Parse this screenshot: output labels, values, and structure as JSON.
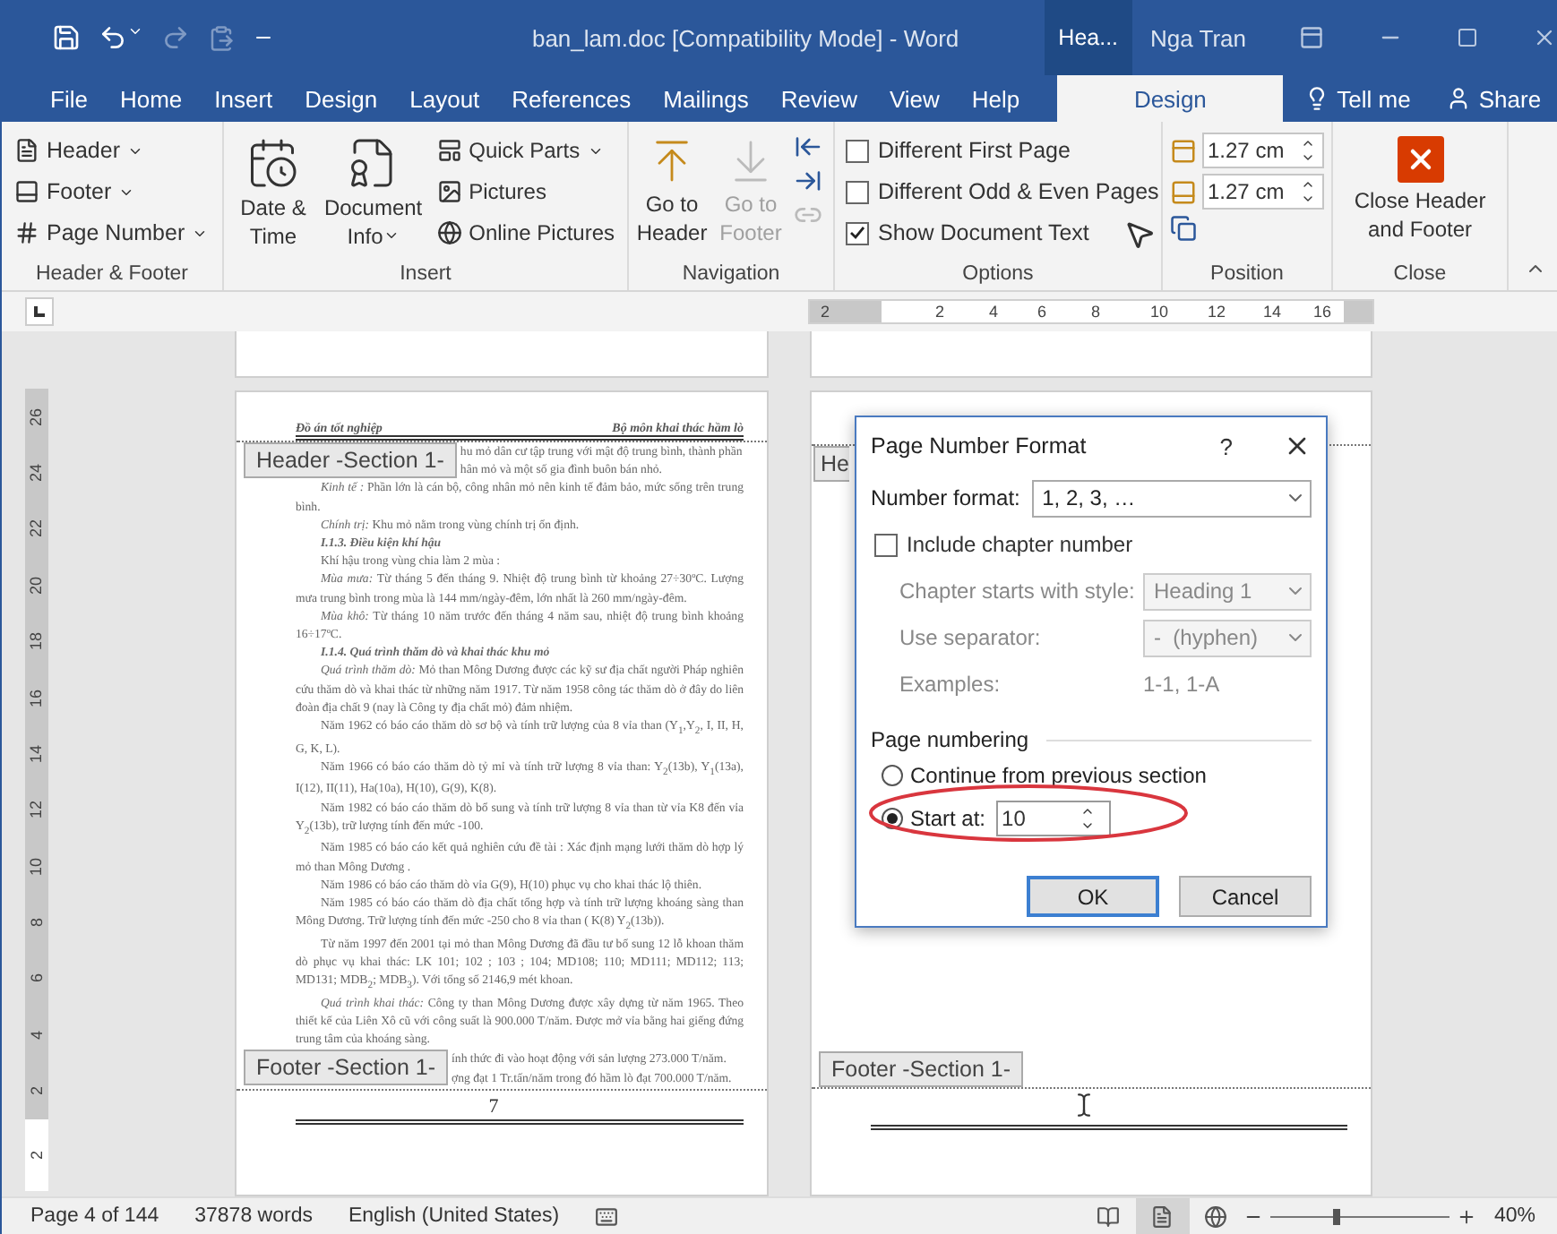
{
  "window": {
    "title": "ban_lam.doc [Compatibility Mode]  -  Word",
    "context_label": "Hea...",
    "user": "Nga Tran"
  },
  "menu_tabs": [
    {
      "label": "File",
      "selected": false
    },
    {
      "label": "Home",
      "selected": false
    },
    {
      "label": "Insert",
      "selected": false
    },
    {
      "label": "Design",
      "selected": false
    },
    {
      "label": "Layout",
      "selected": false
    },
    {
      "label": "References",
      "selected": false
    },
    {
      "label": "Mailings",
      "selected": false
    },
    {
      "label": "Review",
      "selected": false
    },
    {
      "label": "View",
      "selected": false
    },
    {
      "label": "Help",
      "selected": false
    },
    {
      "label": "Design",
      "selected": true
    }
  ],
  "tell_me": "Tell me",
  "share": "Share",
  "ribbon": {
    "header_footer": {
      "label": "Header & Footer",
      "buttons": [
        {
          "label": "Header",
          "dropdown": true
        },
        {
          "label": "Footer",
          "dropdown": true
        },
        {
          "label": "Page Number",
          "dropdown": true
        }
      ]
    },
    "insert": {
      "label": "Insert",
      "large": [
        {
          "label": "Date & Time",
          "dropdown": false
        },
        {
          "label": "Document Info",
          "dropdown": true
        }
      ],
      "small": [
        {
          "label": "Quick Parts",
          "dropdown": true
        },
        {
          "label": "Pictures",
          "dropdown": false
        },
        {
          "label": "Online Pictures",
          "dropdown": false
        }
      ]
    },
    "navigation": {
      "label": "Navigation",
      "buttons": [
        {
          "label": "Go to Header",
          "disabled": false
        },
        {
          "label": "Go to Footer",
          "disabled": true
        }
      ]
    },
    "options": {
      "label": "Options",
      "checks": [
        {
          "label": "Different First Page",
          "checked": false
        },
        {
          "label": "Different Odd & Even Pages",
          "checked": false
        },
        {
          "label": "Show Document Text",
          "checked": true
        }
      ]
    },
    "position": {
      "label": "Position",
      "fields": [
        "1.27 cm",
        "1.27 cm"
      ]
    },
    "close": {
      "label": "Close",
      "button": "Close Header and Footer"
    }
  },
  "ruler": {
    "horizontal": [
      "2",
      "2",
      "4",
      "6",
      "8",
      "10",
      "12",
      "14",
      "16"
    ],
    "vertical": [
      "26",
      "24",
      "22",
      "20",
      "18",
      "16",
      "14",
      "12",
      "10",
      "8",
      "6",
      "4",
      "2"
    ],
    "vertical_below": "2"
  },
  "document": {
    "left_page": {
      "header_left": "Đồ án tốt nghiệp",
      "header_right": "Bộ môn khai thác hầm lò",
      "header_tag": "Header -Section 1-",
      "header_aside": [
        "hu mỏ dân cư tập trung với mật độ trung bình, thành phần",
        "hân mỏ và một số gia đình buôn bán nhỏ."
      ],
      "paragraphs": [
        {
          "kind": "body",
          "text": "*Kinh tế :* Phần lớn là cán bộ, công nhân mỏ nên kinh tế đảm bảo, mức sống trên trung bình."
        },
        {
          "kind": "body",
          "text": "*Chính trị:* Khu mỏ nằm trong vùng chính trị ổn định."
        },
        {
          "kind": "heading",
          "text": "I.1.3. Điều kiện khí hậu"
        },
        {
          "kind": "body",
          "text": "Khí hậu trong vùng chia làm 2 mùa :"
        },
        {
          "kind": "body",
          "text": "*Mùa mưa:* Từ tháng 5 đến tháng 9. Nhiệt độ trung bình từ khoảng 27÷30ºC. Lượng mưa trung bình trong mùa là 144 mm/ngày-đêm, lớn nhất là 260 mm/ngày-đêm."
        },
        {
          "kind": "body",
          "text": "*Mùa khô:* Từ tháng 10 năm trước đến tháng 4 năm sau, nhiệt độ trung bình khoảng 16÷17ºC."
        },
        {
          "kind": "heading",
          "text": "I.1.4. Quá trình thăm dò và khai thác khu mỏ"
        },
        {
          "kind": "body",
          "text": "*Quá trình thăm dò:* Mỏ than Mông Dương được các kỹ sư địa chất người Pháp nghiên cứu thăm dò và khai thác từ những năm 1917. Từ năm 1958 công tác thăm dò ở đây do liên đoàn địa chất 9 (nay là Công ty địa chất mỏ) đảm nhiệm."
        },
        {
          "kind": "body",
          "text": "Năm 1962 có báo cáo thăm dò sơ bộ và tính trữ lượng của 8 vỉa than (Y$_{1}$,Y$_{2}$, I, II, H, G, K, L)."
        },
        {
          "kind": "body",
          "text": "Năm 1966 có báo cáo thăm dò tỷ mỉ và tính trữ lượng 8 vỉa than: Y$_{2}$(13b), Y$_{1}$(13a), I(12), II(11), Ha(10a), H(10), G(9), K(8)."
        },
        {
          "kind": "body",
          "text": "Năm 1982 có báo cáo thăm dò bổ sung và tính trữ lượng 8 vỉa than từ vỉa K8 đến vỉa Y$_{2}$(13b), trữ lượng tính đến mức -100."
        },
        {
          "kind": "body",
          "text": "Năm 1985 có báo cáo kết quả nghiên cứu đề tài : Xác định mạng lưới thăm dò hợp lý mỏ than Mông Dương ."
        },
        {
          "kind": "body",
          "text": "Năm 1986 có báo cáo thăm dò vỉa G(9), H(10) phục vụ cho khai thác lộ thiên."
        },
        {
          "kind": "body",
          "text": "Năm 1985 có báo cáo thăm dò địa chất tổng hợp và tính trữ lượng khoáng sàng than Mông Dương. Trữ lượng tính đến mức -250 cho 8 vỉa than ( K(8) Y$_{2}$(13b))."
        },
        {
          "kind": "body",
          "text": "Từ năm 1997 đến 2001 tại mỏ than Mông Dương đã đầu tư bổ sung 12 lỗ khoan thăm dò phục vụ khai thác: LK 101; 102 ; 103 ; 104; MD108; 110; MD111; MD112; 113; MD131; MDB$_{2}$; MDB$_{3}$). Với tổng số 2146,9 mét khoan."
        },
        {
          "kind": "body",
          "text": "*Quá trình khai thác:* Công ty than Mông Dương được xây dựng từ năm 1965. Theo thiết kế của Liên Xô cũ với công suất là 900.000 T/năm. Được mở vỉa bằng hai giếng đứng trung tâm của khoáng sàng."
        }
      ],
      "footer_aside": [
        "ính thức đi vào hoạt động với sản lượng 273.000 T/năm.",
        "ợng đạt 1 Tr.tấn/năm trong đó hầm lò đạt 700.000 T/năm."
      ],
      "footer_tag": "Footer -Section 1-",
      "page_number": "7"
    },
    "right_page": {
      "header_tag": "He",
      "footer_tag": "Footer -Section 1-"
    }
  },
  "dialog": {
    "title": "Page Number Format",
    "help": "?",
    "number_format": {
      "label": "Number format:",
      "value": "1, 2, 3, …",
      "disabled": false
    },
    "include_chapter": {
      "label": "Include chapter number",
      "checked": false
    },
    "chapter_style": {
      "label": "Chapter starts with style:",
      "value": "Heading 1",
      "disabled": true
    },
    "separator": {
      "label": "Use separator:",
      "value": "-  (hyphen)",
      "disabled": true
    },
    "examples": {
      "label": "Examples:",
      "value": "1-1, 1-A"
    },
    "section_label": "Page numbering",
    "radios": [
      {
        "label": "Continue from previous section",
        "selected": false
      },
      {
        "label": "Start at:",
        "selected": true
      }
    ],
    "start_at": "10",
    "buttons": [
      {
        "label": "OK",
        "default": true
      },
      {
        "label": "Cancel",
        "default": false
      }
    ]
  },
  "status_bar": {
    "page": "Page 4 of 144",
    "words": "37878 words",
    "language": "English (United States)",
    "zoom_slider": {
      "level": 0.35
    },
    "zoom": "40%"
  }
}
